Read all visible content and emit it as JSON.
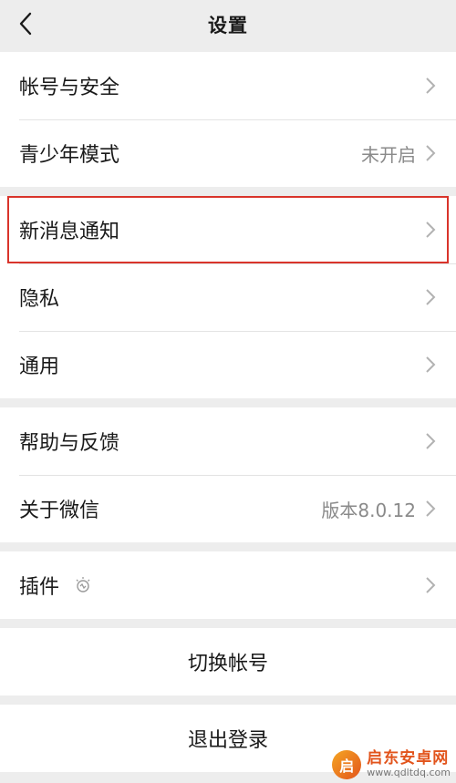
{
  "nav": {
    "title": "设置"
  },
  "groups": [
    [
      {
        "label": "帐号与安全",
        "value": ""
      },
      {
        "label": "青少年模式",
        "value": "未开启"
      }
    ],
    [
      {
        "label": "新消息通知",
        "value": ""
      },
      {
        "label": "隐私",
        "value": ""
      },
      {
        "label": "通用",
        "value": ""
      }
    ],
    [
      {
        "label": "帮助与反馈",
        "value": ""
      },
      {
        "label": "关于微信",
        "value": "版本8.0.12"
      }
    ],
    [
      {
        "label": "插件",
        "value": ""
      }
    ]
  ],
  "actions": {
    "switch_account": "切换帐号",
    "logout": "退出登录"
  },
  "icons": {
    "back": "chevron-left-icon",
    "arrow": "chevron-right-icon",
    "plugin": "plugin-bulb-icon"
  },
  "colors": {
    "highlight_border": "#d9342b",
    "background": "#ededed"
  },
  "watermark": {
    "name": "启东安卓网",
    "url": "www.qdltdq.com",
    "logo_char": "启"
  }
}
